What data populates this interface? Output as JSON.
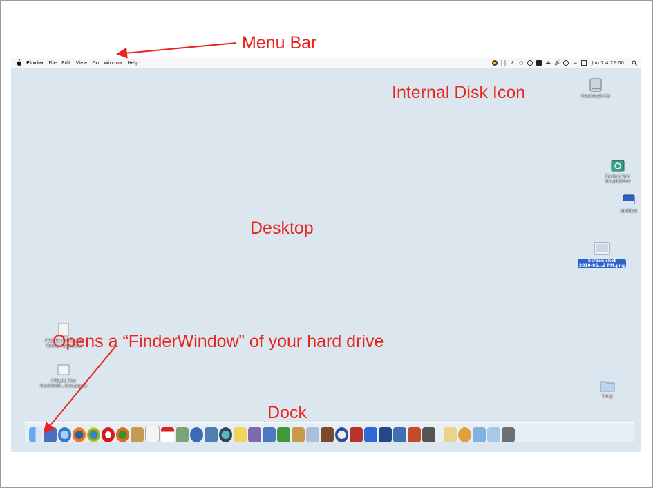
{
  "annotations": {
    "menu_bar": "Menu Bar",
    "internal_disk_icon": "Internal Disk Icon",
    "desktop": "Desktop",
    "opens_finder": "Opens a “FinderWindow” of your hard drive",
    "dock": "Dock"
  },
  "menubar": {
    "items": [
      "Finder",
      "File",
      "Edit",
      "View",
      "Go",
      "Window",
      "Help"
    ],
    "clock": "Jun 7  4:22:00"
  },
  "desktop_icons": {
    "macintosh_hd": "Macintosh HD",
    "backup_drive": "Backup Two\nSimpleDrive",
    "unlabeled_partial": "Untitled",
    "screenshot": "Screen shot\n2010-06...2 PM.png",
    "pdf_doc_1": "PTSLPC Pre-Retire\nTimely Payments",
    "pdf_doc_2": "PTSLPC The\nMacintosh...tion.pages",
    "temp_folder": "Temp"
  },
  "colors": {
    "annotation": "#e8241c",
    "desktop_bg": "#dbe6ef"
  }
}
